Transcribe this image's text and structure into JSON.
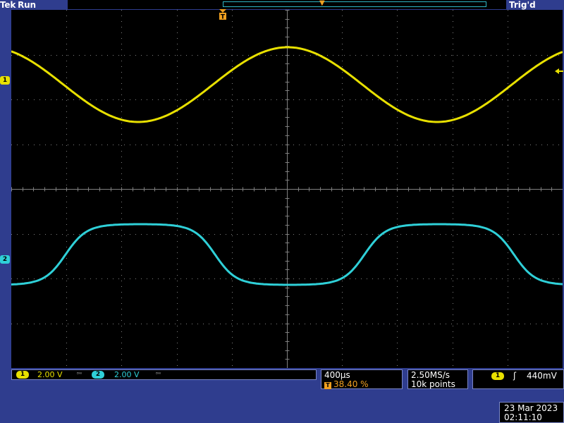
{
  "header": {
    "brand": "Tek",
    "acq_state": "Run",
    "trigger_status": "Trig'd"
  },
  "markers": {
    "ch1": "1",
    "ch2": "2",
    "trigger_position": "T"
  },
  "channels": [
    {
      "label": "1",
      "scale": "2.00 V",
      "color": "#e8e000"
    },
    {
      "label": "2",
      "scale": "2.00 V",
      "color": "#2fd0d8"
    }
  ],
  "timebase": {
    "horizontal_scale": "400µs",
    "trigger_pos_icon": "T",
    "trigger_position": "38.40 %"
  },
  "acquisition": {
    "sample_rate": "2.50MS/s",
    "record_length": "10k points"
  },
  "trigger": {
    "source": "1",
    "slope_icon": "rising-edge-icon",
    "slope_glyph": "ʃ",
    "level": "440mV"
  },
  "datetime": {
    "date": "23 Mar 2023",
    "time": "02:11:10"
  },
  "colors": {
    "background": "#2f3d8e",
    "graticule": "#808080",
    "ch1": "#e8e000",
    "ch2": "#2fd0d8",
    "trigger": "#f0a020"
  }
}
